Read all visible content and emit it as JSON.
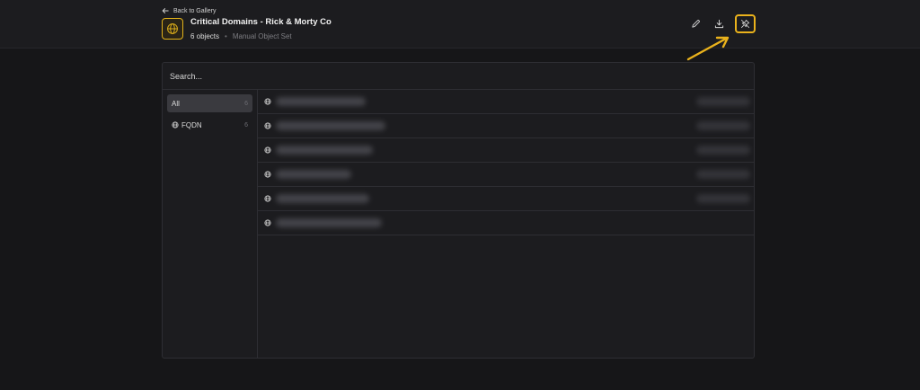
{
  "header": {
    "back_label": "Back to Gallery",
    "title": "Critical Domains - Rick & Morty Co",
    "object_count": "6 objects",
    "separator": "•",
    "set_type": "Manual Object Set"
  },
  "toolbar": {
    "actions": [
      "edit-icon",
      "download-icon",
      "unpin-icon"
    ],
    "highlighted_action": "unpin-icon"
  },
  "search": {
    "placeholder": "Search..."
  },
  "filters": [
    {
      "label": "All",
      "count": "6",
      "active": true
    },
    {
      "label": "FQDN",
      "count": "6",
      "icon": "globe-icon"
    }
  ],
  "objects": [
    {
      "icon": "globe-icon",
      "name_blurred": true
    },
    {
      "icon": "globe-icon",
      "name_blurred": true
    },
    {
      "icon": "globe-icon",
      "name_blurred": true
    },
    {
      "icon": "globe-icon",
      "name_blurred": true
    },
    {
      "icon": "globe-icon",
      "name_blurred": true
    },
    {
      "icon": "globe-icon",
      "name_blurred": true
    }
  ],
  "colors": {
    "accent": "#e2b21a",
    "background": "#161618",
    "panel": "#1c1c1f",
    "border": "#2e2e33"
  }
}
